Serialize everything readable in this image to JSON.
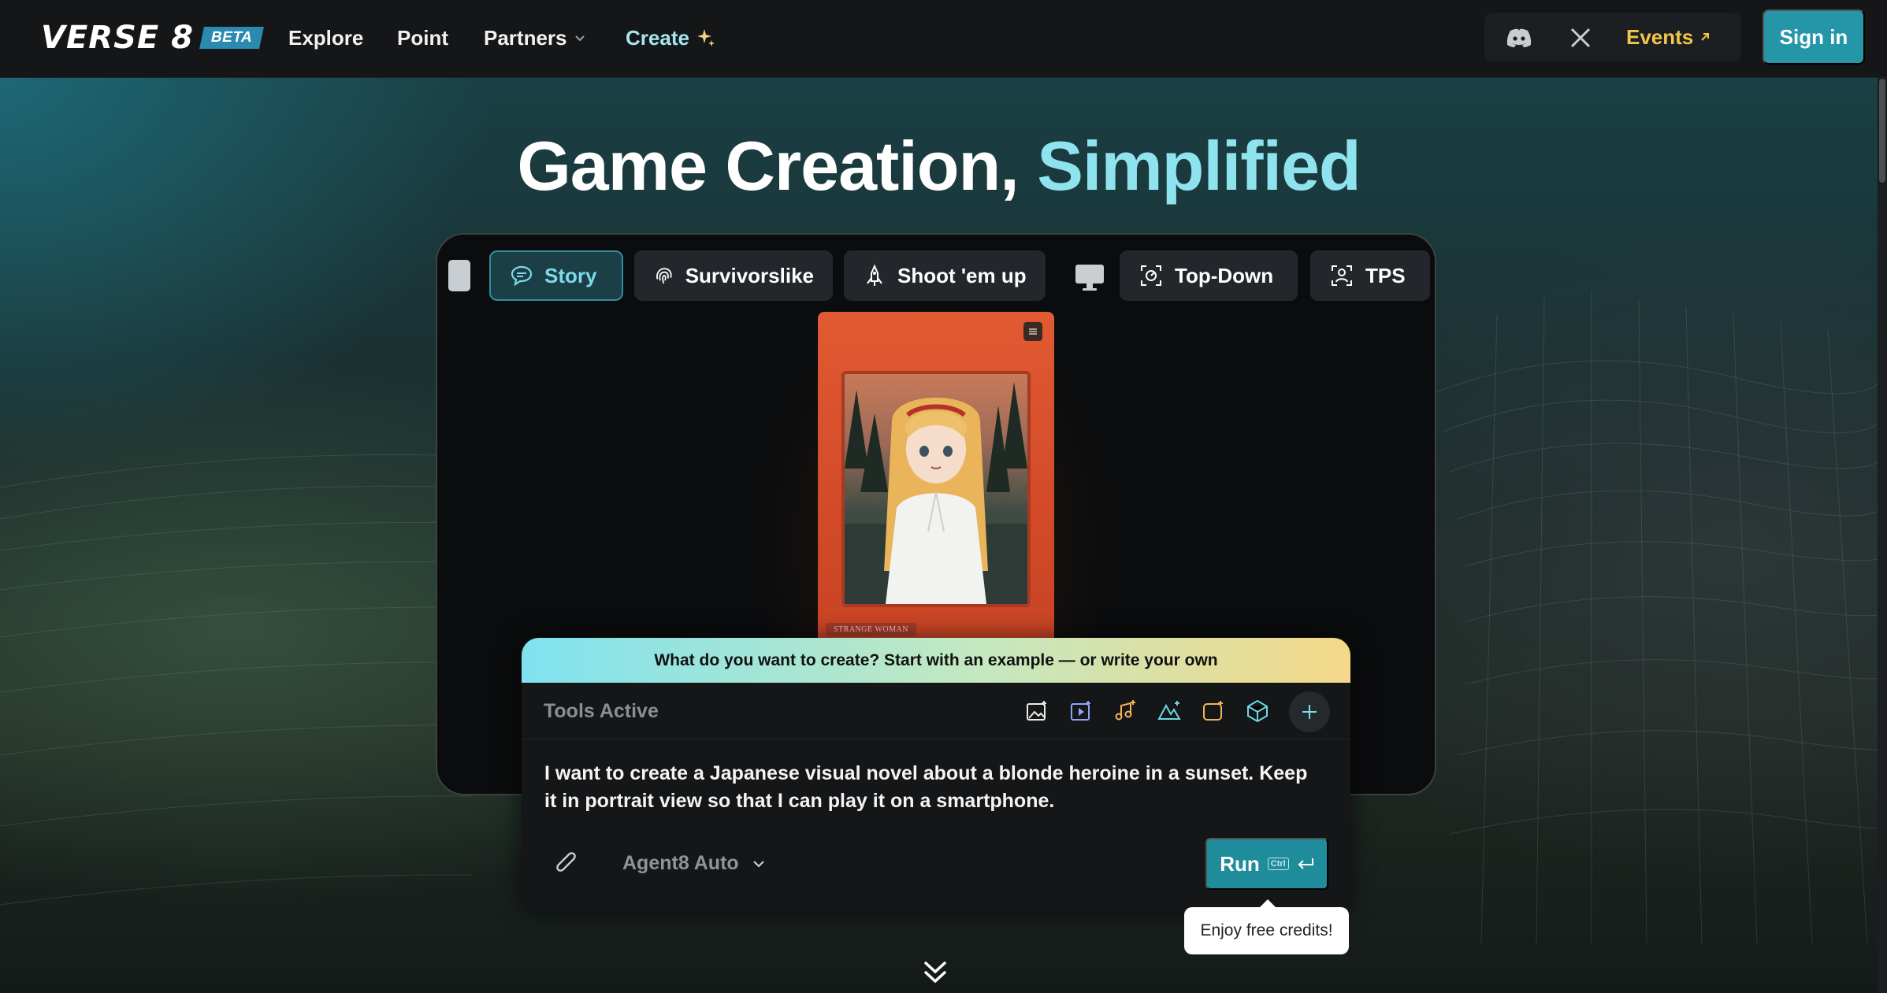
{
  "nav": {
    "logo": "VERSE 8",
    "logo_badge": "BETA",
    "links": [
      "Explore",
      "Point",
      "Partners",
      "Create"
    ],
    "events": "Events",
    "sign_in": "Sign in"
  },
  "hero": {
    "title_main": "Game Creation,",
    "title_accent": "Simplified"
  },
  "demo": {
    "tabs": [
      "Story",
      "Survivorslike",
      "Shoot 'em up",
      "Top-Down",
      "TPS"
    ],
    "active_tab": "Story",
    "card_label": "STRANGE WOMAN"
  },
  "prompt": {
    "header": "What do you want to create? Start with an example — or write your own",
    "tools_label": "Tools Active",
    "text": "I want to create a Japanese visual novel about a blonde heroine in a sunset. Keep it in portrait view so that I can play it on a smartphone.",
    "agent": "Agent8 Auto",
    "run": "Run",
    "run_kbd": "Ctrl"
  },
  "tooltip": "Enjoy free credits!",
  "colors": {
    "accent": "#8fe3ef",
    "run": "#1f8c9c",
    "events": "#f3c64b",
    "sign_in": "#2596a8"
  }
}
